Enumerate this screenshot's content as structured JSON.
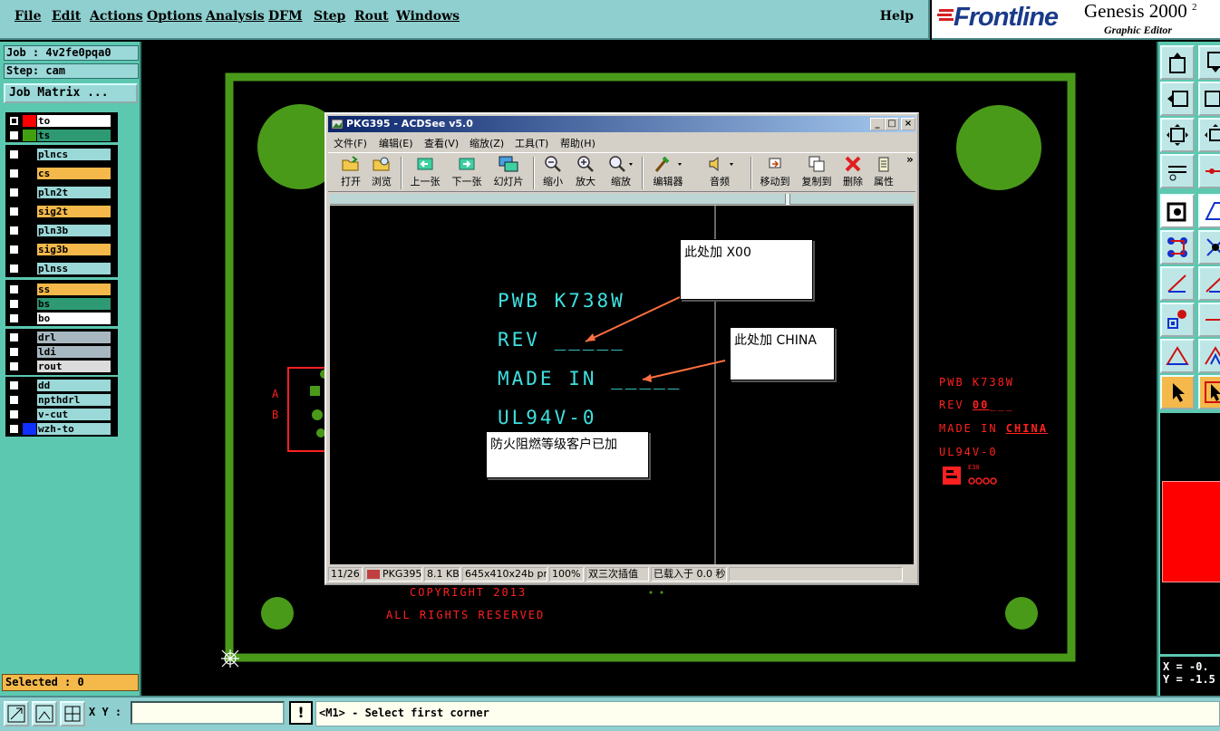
{
  "menubar": {
    "items": [
      "File",
      "Edit",
      "Actions",
      "Options",
      "Analysis",
      "DFM",
      "Step",
      "Rout",
      "Windows"
    ],
    "help": "Help"
  },
  "logo": {
    "brand": "Frontline",
    "product": "Genesis 2000",
    "product_suffix": "2",
    "subtitle": "Graphic Editor"
  },
  "job": {
    "job_label": "Job : 4v2fe0pqa0",
    "step_label": "Step: cam",
    "matrix_button": "Job Matrix ..."
  },
  "layers": [
    {
      "name": "to",
      "color": "#ff0000",
      "bg": "#ffffff",
      "checked": true
    },
    {
      "name": "ts",
      "color": "#40a010",
      "bg": "#2e9a74",
      "checked": false
    },
    {
      "name": "plncs",
      "color": "#000000",
      "bg": "#9bd8d8",
      "checked": false
    },
    {
      "name": "cs",
      "color": "#000000",
      "bg": "#f4b94a",
      "checked": false
    },
    {
      "name": "pln2t",
      "color": "#000000",
      "bg": "#9bd8d8",
      "checked": false
    },
    {
      "name": "sig2t",
      "color": "#000000",
      "bg": "#f4b94a",
      "checked": false
    },
    {
      "name": "pln3b",
      "color": "#000000",
      "bg": "#9bd8d8",
      "checked": false
    },
    {
      "name": "sig3b",
      "color": "#000000",
      "bg": "#f4b94a",
      "checked": false
    },
    {
      "name": "plnss",
      "color": "#000000",
      "bg": "#9bd8d8",
      "checked": false
    },
    {
      "name": "ss",
      "color": "#000000",
      "bg": "#f4b94a",
      "checked": false
    },
    {
      "name": "bs",
      "color": "#000000",
      "bg": "#2e9a74",
      "checked": false
    },
    {
      "name": "bo",
      "color": "#000000",
      "bg": "#ffffff",
      "checked": false
    },
    {
      "name": "drl",
      "color": "#000000",
      "bg": "#a8b8c0",
      "checked": false
    },
    {
      "name": "ldi",
      "color": "#000000",
      "bg": "#a8b8c0",
      "checked": false
    },
    {
      "name": "rout",
      "color": "#000000",
      "bg": "#dcdcdc",
      "checked": false
    },
    {
      "name": "dd",
      "color": "#000000",
      "bg": "#9bd8d8",
      "checked": false
    },
    {
      "name": "npthdrl",
      "color": "#000000",
      "bg": "#9bd8d8",
      "checked": false
    },
    {
      "name": "v-cut",
      "color": "#000000",
      "bg": "#9bd8d8",
      "checked": false
    },
    {
      "name": "wzh-to",
      "color": "#1030ff",
      "bg": "#9bd8d8",
      "checked": false
    }
  ],
  "selected": "Selected : 0",
  "bottom": {
    "xy_label": "X Y :",
    "xy_value": "",
    "excl": "!",
    "status": "<M1> - Select first corner"
  },
  "coords": {
    "x": "X = -0.",
    "y": "Y = -1.5"
  },
  "canvas": {
    "copyright": "COPYRIGHT 2013",
    "rights": "ALL RIGHTS RESERVED",
    "side_a": "A",
    "side_b": "B",
    "red_block": [
      "PWB K738W",
      "REV ",
      "00",
      "MADE IN ",
      "CHINA",
      "UL94V-0",
      "E30"
    ]
  },
  "acdsee": {
    "title": "PKG395 - ACDSee v5.0",
    "menu": [
      "文件(F)",
      "编辑(E)",
      "查看(V)",
      "缩放(Z)",
      "工具(T)",
      "帮助(H)"
    ],
    "toolbar": [
      "打开",
      "浏览",
      "上一张",
      "下一张",
      "幻灯片",
      "缩小",
      "放大",
      "缩放",
      "编辑器",
      "音频",
      "移动到",
      "复制到",
      "删除",
      "属性"
    ],
    "image": {
      "line1": "PWB K738W",
      "line2": "REV _____",
      "line3": "MADE IN _____",
      "line4": "UL94V-0",
      "callout1": "此处加 X00",
      "callout2": "此处加 CHINA",
      "callout3": "防火阻燃等级客户已加"
    },
    "status": [
      "11/26",
      "PKG395",
      "8.1 KB",
      "645x410x24b png",
      "100%",
      "双三次插值",
      "已载入于 0.0 秒"
    ]
  },
  "colors": {
    "panel": "#5cc8b0",
    "menubar": "#8fcfcf",
    "board_outline": "#4a9a1a",
    "silk_cyan": "#3fe0e0",
    "red_layer": "#ff2020",
    "selected_bg": "#f4b94a"
  }
}
